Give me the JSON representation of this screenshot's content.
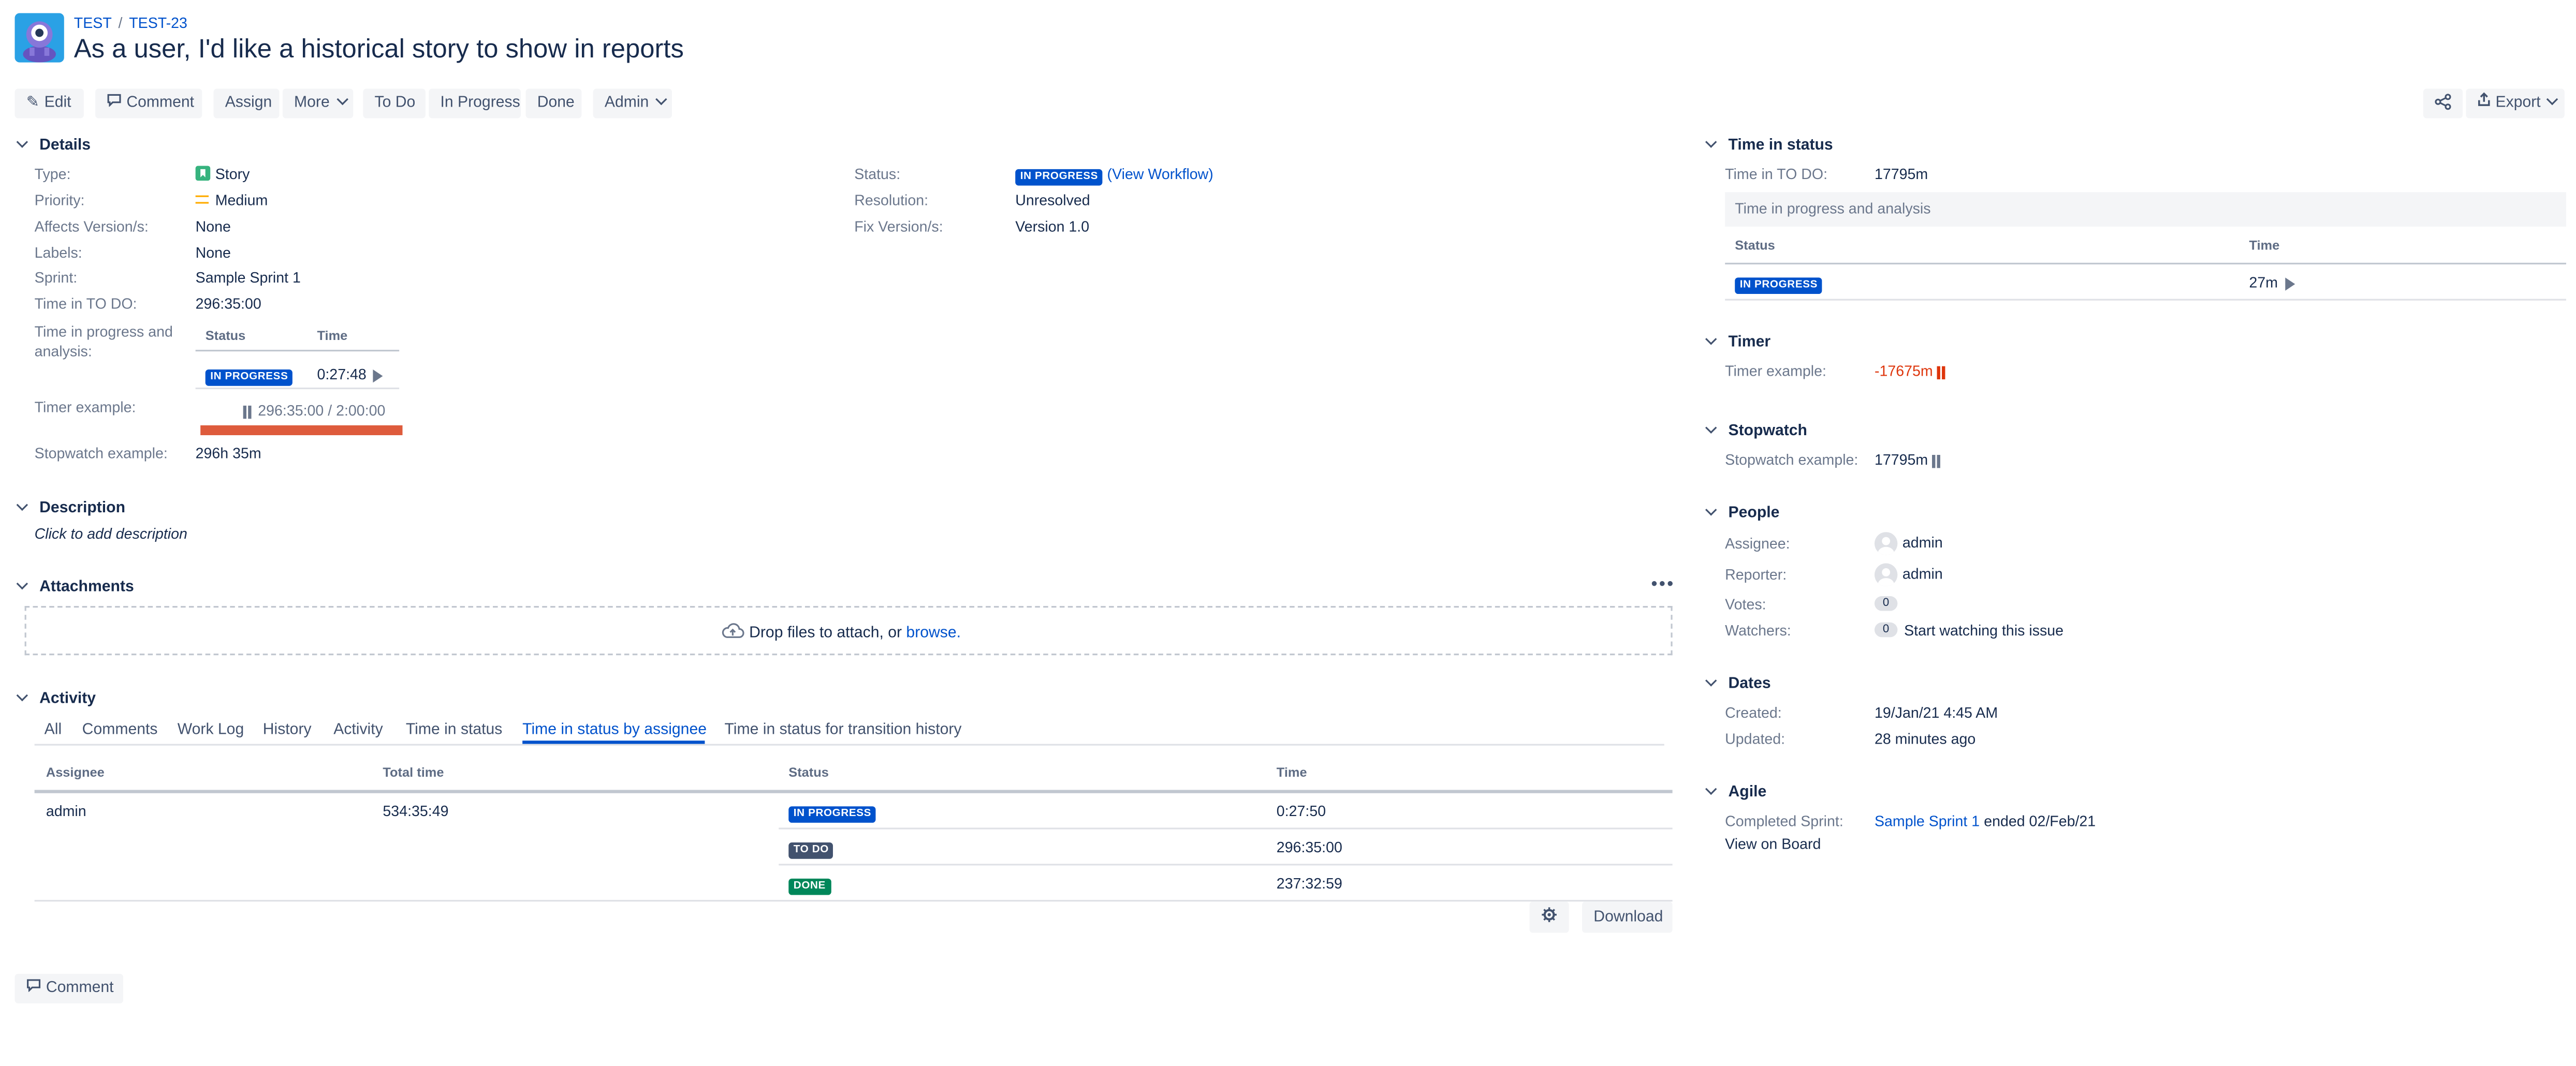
{
  "breadcrumb": {
    "project": "TEST",
    "issue_key": "TEST-23"
  },
  "title": "As a user, I'd like a historical story to show in reports",
  "toolbar": {
    "edit": "Edit",
    "comment": "Comment",
    "assign": "Assign",
    "more": "More",
    "todo": "To Do",
    "in_progress": "In Progress",
    "done": "Done",
    "admin": "Admin",
    "export": "Export"
  },
  "details": {
    "header": "Details",
    "type_label": "Type:",
    "type_value": "Story",
    "priority_label": "Priority:",
    "priority_value": "Medium",
    "affects_label": "Affects Version/s:",
    "affects_value": "None",
    "labels_label": "Labels:",
    "labels_value": "None",
    "sprint_label": "Sprint:",
    "sprint_value": "Sample Sprint 1",
    "time_todo_label": "Time in TO DO:",
    "time_todo_value": "296:35:00",
    "tipa_label": "Time in progress and analysis:",
    "tipa_col_status": "Status",
    "tipa_col_time": "Time",
    "tipa_status": "IN PROGRESS",
    "tipa_time": "0:27:48",
    "timer_label": "Timer example:",
    "timer_value": "296:35:00 / 2:00:00",
    "timer_progress": 1.0,
    "stopwatch_label": "Stopwatch example:",
    "stopwatch_value": "296h 35m",
    "status_label": "Status:",
    "status_value": "IN PROGRESS",
    "view_workflow": "View Workflow",
    "resolution_label": "Resolution:",
    "resolution_value": "Unresolved",
    "fix_label": "Fix Version/s:",
    "fix_value": "Version 1.0"
  },
  "description": {
    "header": "Description",
    "placeholder": "Click to add description"
  },
  "attachments": {
    "header": "Attachments",
    "drop_text": "Drop files to attach, or",
    "browse": "browse."
  },
  "activity": {
    "header": "Activity",
    "tabs": [
      "All",
      "Comments",
      "Work Log",
      "History",
      "Activity",
      "Time in status",
      "Time in status by assignee",
      "Time in status for transition history"
    ],
    "active_tab": "Time in status by assignee",
    "columns": [
      "Assignee",
      "Total time",
      "Status",
      "Time"
    ],
    "assignee": "admin",
    "total_time": "534:35:49",
    "rows": [
      {
        "status": "IN PROGRESS",
        "time": "0:27:50"
      },
      {
        "status": "TO DO",
        "time": "296:35:00"
      },
      {
        "status": "DONE",
        "time": "237:32:59"
      }
    ],
    "download": "Download"
  },
  "bottom_comment": "Comment",
  "sidebar": {
    "time_in_status": {
      "header": "Time in status",
      "todo_label": "Time in TO DO:",
      "todo_value": "17795m",
      "sub_header": "Time in progress and analysis",
      "col_status": "Status",
      "col_time": "Time",
      "row_status": "IN PROGRESS",
      "row_time": "27m"
    },
    "timer": {
      "header": "Timer",
      "label": "Timer example:",
      "value": "-17675m"
    },
    "stopwatch": {
      "header": "Stopwatch",
      "label": "Stopwatch example:",
      "value": "17795m"
    },
    "people": {
      "header": "People",
      "assignee_label": "Assignee:",
      "assignee_value": "admin",
      "reporter_label": "Reporter:",
      "reporter_value": "admin",
      "votes_label": "Votes:",
      "votes_value": "0",
      "watchers_label": "Watchers:",
      "watchers_value": "0",
      "watch_link": "Start watching this issue"
    },
    "dates": {
      "header": "Dates",
      "created_label": "Created:",
      "created_value": "19/Jan/21 4:45 AM",
      "updated_label": "Updated:",
      "updated_value": "28 minutes ago"
    },
    "agile": {
      "header": "Agile",
      "completed_label": "Completed Sprint:",
      "sprint_link": "Sample Sprint 1",
      "sprint_ended": "ended 02/Feb/21",
      "view_board": "View on Board"
    }
  },
  "colors": {
    "link": "#0052cc",
    "in_progress": "#0052cc",
    "todo": "#42526e",
    "done": "#00875a",
    "timer_bar": "#de5b3c",
    "negative": "#de350b"
  }
}
